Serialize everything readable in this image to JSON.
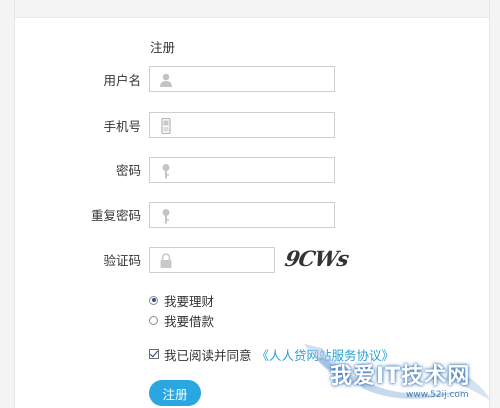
{
  "form": {
    "title": "注册",
    "fields": [
      {
        "label": "用户名",
        "value": "",
        "icon": "user-icon"
      },
      {
        "label": "手机号",
        "value": "",
        "icon": "phone-icon"
      },
      {
        "label": "密码",
        "value": "",
        "icon": "key-icon"
      },
      {
        "label": "重复密码",
        "value": "",
        "icon": "key-icon"
      },
      {
        "label": "验证码",
        "value": "",
        "icon": "lock-icon"
      }
    ],
    "captcha_text": "9CWs",
    "purpose_options": [
      {
        "label": "我要理财",
        "checked": true
      },
      {
        "label": "我要借款",
        "checked": false
      }
    ],
    "agreement": {
      "checked": true,
      "text": "我已阅读并同意",
      "link_text": "《人人贷网站服务协议》"
    },
    "submit_label": "注册"
  },
  "watermark": {
    "text": "我爱IT技术网",
    "subtext": "www.52ij.com"
  },
  "colors": {
    "accent": "#2aa7e0",
    "link": "#2a9fd6",
    "border": "#cfcfcf",
    "text": "#333333"
  }
}
